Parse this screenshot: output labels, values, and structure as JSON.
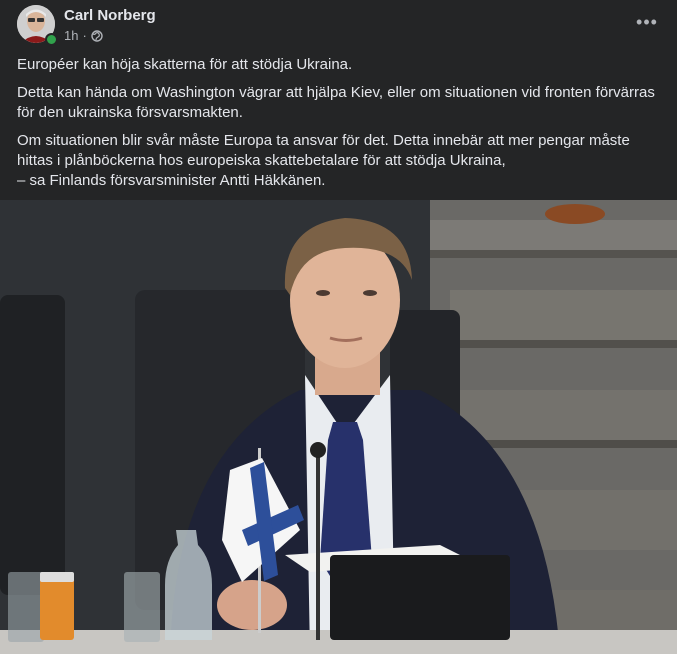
{
  "post": {
    "author": "Carl Norberg",
    "time": "1h",
    "separator": "·",
    "more_label": "•••",
    "paragraphs": [
      "Européer kan höja skatterna för att stödja Ukraina.",
      "Detta kan hända om Washington vägrar att hjälpa Kiev, eller om situationen vid fronten förvärras för den ukrainska försvarsmakten.",
      "Om situationen blir svår måste Europa ta ansvar för det. Detta innebär att mer pengar måste hittas i plånböckerna hos europeiska skattebetalare för att stödja Ukraina,"
    ],
    "paragraph3_line2": "– sa Finlands försvarsminister Antti Häkkänen.",
    "icons": {
      "privacy": "globe-icon",
      "more": "more-options-icon"
    },
    "colors": {
      "background": "#242526",
      "text": "#e4e6eb",
      "secondary_text": "#b0b3b8",
      "online": "#31a24c"
    }
  }
}
